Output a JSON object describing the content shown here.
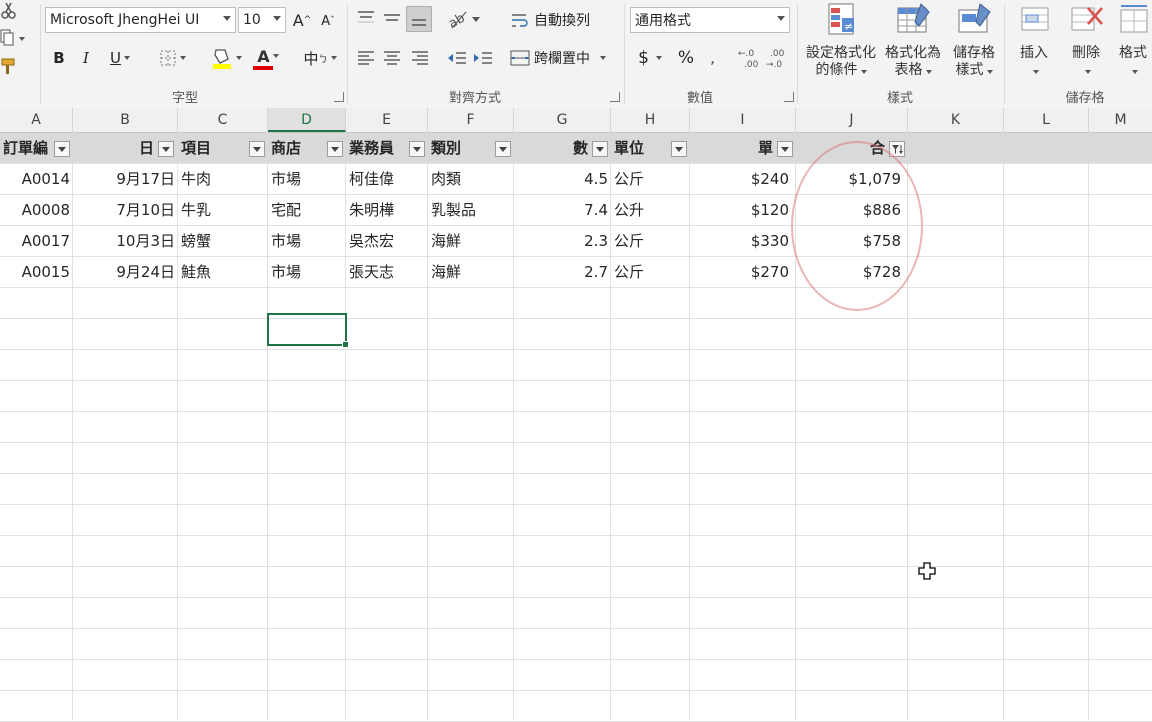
{
  "ribbon": {
    "font": {
      "name": "Microsoft JhengHei UI",
      "size": "10",
      "group_label": "字型"
    },
    "alignment": {
      "wrap_text": "自動換列",
      "merge_center": "跨欄置中",
      "group_label": "對齊方式"
    },
    "number": {
      "format": "通用格式",
      "group_label": "數值",
      "currency_symbol": "$",
      "percent_symbol": "%"
    },
    "styles": {
      "conditional_line1": "設定格式化",
      "conditional_line2": "的條件",
      "table_line1": "格式化為",
      "table_line2": "表格",
      "cell_line1": "儲存格",
      "cell_line2": "樣式",
      "group_label": "樣式"
    },
    "cells": {
      "insert": "插入",
      "delete": "刪除",
      "format": "格式",
      "group_label": "儲存格"
    },
    "buttons": {
      "bold": "B",
      "italic": "I",
      "underline": "U",
      "grow": "A",
      "shrink": "A",
      "font_color": "A",
      "phonetic": "中"
    }
  },
  "columns": [
    "A",
    "B",
    "C",
    "D",
    "E",
    "F",
    "G",
    "H",
    "I",
    "J",
    "K",
    "L",
    "M"
  ],
  "table": {
    "headers": [
      "訂單編",
      "日",
      "項目",
      "商店",
      "業務員",
      "類別",
      "數",
      "單位",
      "單",
      "合"
    ],
    "rows": [
      [
        "A0014",
        "9月17日",
        "牛肉",
        "市場",
        "柯佳偉",
        "肉類",
        "4.5",
        "公斤",
        "$240",
        "$1,079"
      ],
      [
        "A0008",
        "7月10日",
        "牛乳",
        "宅配",
        "朱明樺",
        "乳製品",
        "7.4",
        "公升",
        "$120",
        "$886"
      ],
      [
        "A0017",
        "10月3日",
        "螃蟹",
        "市場",
        "吳杰宏",
        "海鮮",
        "2.3",
        "公斤",
        "$330",
        "$758"
      ],
      [
        "A0015",
        "9月24日",
        "鮭魚",
        "市場",
        "張天志",
        "海鮮",
        "2.7",
        "公斤",
        "$270",
        "$728"
      ]
    ]
  },
  "colors": {
    "accent": "#217346",
    "header_fill": "#d9d9d9",
    "annotation": "#dc7878"
  }
}
